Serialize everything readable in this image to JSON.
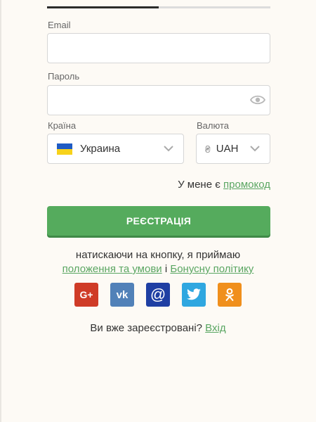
{
  "progress": {
    "fraction": 0.5
  },
  "form": {
    "email": {
      "label": "Email",
      "value": "",
      "placeholder": ""
    },
    "password": {
      "label": "Пароль",
      "value": "",
      "placeholder": ""
    },
    "country": {
      "label": "Країна",
      "selected": "Украина",
      "flag": "ukraine-flag"
    },
    "currency": {
      "label": "Валюта",
      "symbol": "₴",
      "selected": "UAH"
    }
  },
  "promo": {
    "prefix": "У мене є ",
    "link": "промокод"
  },
  "register_button": "РЕЄСТРАЦІЯ",
  "terms": {
    "line1": "натискаючи на кнопку, я приймаю",
    "terms_link": "положення та умови",
    "connector": " і ",
    "bonus_link": "Бонусну політику"
  },
  "socials": [
    {
      "name": "google-plus",
      "glyph": "G+",
      "color": "#cf3b27"
    },
    {
      "name": "vk",
      "glyph": "vk",
      "color": "#5181b8"
    },
    {
      "name": "mail",
      "glyph": "@",
      "color": "#1f3fa3"
    },
    {
      "name": "twitter",
      "glyph": "twitter",
      "color": "#2fa7e0"
    },
    {
      "name": "odnoklassniki",
      "glyph": "ok",
      "color": "#f08f1c"
    }
  ],
  "login": {
    "question": "Ви вже зареєстровані? ",
    "link": "Вхід"
  },
  "colors": {
    "accent_green": "#55ab5d",
    "link_green": "#5aa662",
    "background": "#fdfaf5"
  }
}
